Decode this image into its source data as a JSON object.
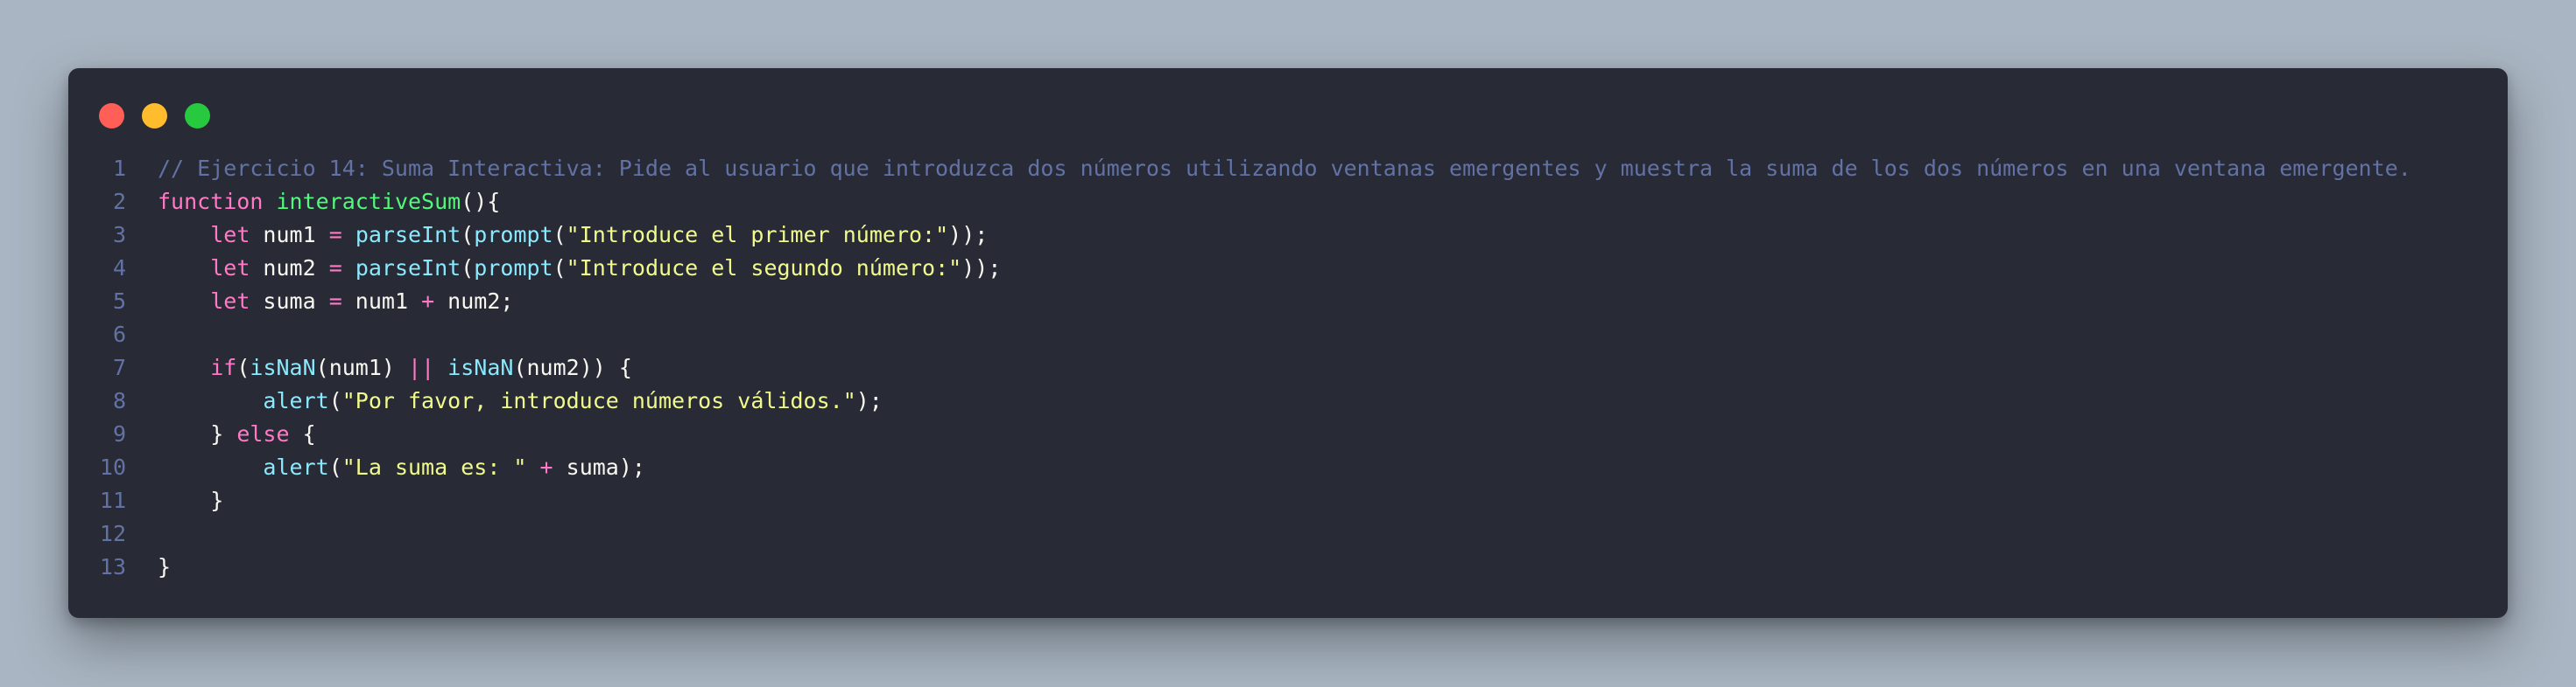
{
  "window": {
    "controls": [
      "close",
      "minimize",
      "maximize"
    ],
    "colors": {
      "background": "#282a36",
      "comment": "#6272a4",
      "keyword": "#ff79c6",
      "function": "#50fa7b",
      "builtin": "#8be9fd",
      "string": "#f1fa8c",
      "plain": "#f8f8f2"
    }
  },
  "code": {
    "lines": [
      {
        "number": "1",
        "tokens": [
          {
            "t": "cm",
            "text": "// Ejercicio 14: Suma Interactiva: Pide al usuario que introduzca dos números utilizando ventanas emergentes y muestra la suma de los dos números en una ventana emergente."
          }
        ]
      },
      {
        "number": "2",
        "tokens": [
          {
            "t": "kw",
            "text": "function"
          },
          {
            "t": "pl",
            "text": " "
          },
          {
            "t": "fn",
            "text": "interactiveSum"
          },
          {
            "t": "pl",
            "text": "(){"
          }
        ]
      },
      {
        "number": "3",
        "tokens": [
          {
            "t": "pl",
            "text": "    "
          },
          {
            "t": "kw",
            "text": "let"
          },
          {
            "t": "pl",
            "text": " num1 "
          },
          {
            "t": "op",
            "text": "="
          },
          {
            "t": "pl",
            "text": " "
          },
          {
            "t": "bi",
            "text": "parseInt"
          },
          {
            "t": "pl",
            "text": "("
          },
          {
            "t": "bi",
            "text": "prompt"
          },
          {
            "t": "pl",
            "text": "("
          },
          {
            "t": "st",
            "text": "\"Introduce el primer número:\""
          },
          {
            "t": "pl",
            "text": "));"
          }
        ]
      },
      {
        "number": "4",
        "tokens": [
          {
            "t": "pl",
            "text": "    "
          },
          {
            "t": "kw",
            "text": "let"
          },
          {
            "t": "pl",
            "text": " num2 "
          },
          {
            "t": "op",
            "text": "="
          },
          {
            "t": "pl",
            "text": " "
          },
          {
            "t": "bi",
            "text": "parseInt"
          },
          {
            "t": "pl",
            "text": "("
          },
          {
            "t": "bi",
            "text": "prompt"
          },
          {
            "t": "pl",
            "text": "("
          },
          {
            "t": "st",
            "text": "\"Introduce el segundo número:\""
          },
          {
            "t": "pl",
            "text": "));"
          }
        ]
      },
      {
        "number": "5",
        "tokens": [
          {
            "t": "pl",
            "text": "    "
          },
          {
            "t": "kw",
            "text": "let"
          },
          {
            "t": "pl",
            "text": " suma "
          },
          {
            "t": "op",
            "text": "="
          },
          {
            "t": "pl",
            "text": " num1 "
          },
          {
            "t": "op",
            "text": "+"
          },
          {
            "t": "pl",
            "text": " num2;"
          }
        ]
      },
      {
        "number": "6",
        "tokens": []
      },
      {
        "number": "7",
        "tokens": [
          {
            "t": "pl",
            "text": "    "
          },
          {
            "t": "kw",
            "text": "if"
          },
          {
            "t": "pl",
            "text": "("
          },
          {
            "t": "bi",
            "text": "isNaN"
          },
          {
            "t": "pl",
            "text": "(num1) "
          },
          {
            "t": "op",
            "text": "||"
          },
          {
            "t": "pl",
            "text": " "
          },
          {
            "t": "bi",
            "text": "isNaN"
          },
          {
            "t": "pl",
            "text": "(num2)) {"
          }
        ]
      },
      {
        "number": "8",
        "tokens": [
          {
            "t": "pl",
            "text": "        "
          },
          {
            "t": "bi",
            "text": "alert"
          },
          {
            "t": "pl",
            "text": "("
          },
          {
            "t": "st",
            "text": "\"Por favor, introduce números válidos.\""
          },
          {
            "t": "pl",
            "text": ");"
          }
        ]
      },
      {
        "number": "9",
        "tokens": [
          {
            "t": "pl",
            "text": "    } "
          },
          {
            "t": "kw",
            "text": "else"
          },
          {
            "t": "pl",
            "text": " {"
          }
        ]
      },
      {
        "number": "10",
        "tokens": [
          {
            "t": "pl",
            "text": "        "
          },
          {
            "t": "bi",
            "text": "alert"
          },
          {
            "t": "pl",
            "text": "("
          },
          {
            "t": "st",
            "text": "\"La suma es: \""
          },
          {
            "t": "pl",
            "text": " "
          },
          {
            "t": "op",
            "text": "+"
          },
          {
            "t": "pl",
            "text": " suma);"
          }
        ]
      },
      {
        "number": "11",
        "tokens": [
          {
            "t": "pl",
            "text": "    }"
          }
        ]
      },
      {
        "number": "12",
        "tokens": []
      },
      {
        "number": "13",
        "tokens": [
          {
            "t": "pl",
            "text": "}"
          }
        ]
      }
    ]
  }
}
